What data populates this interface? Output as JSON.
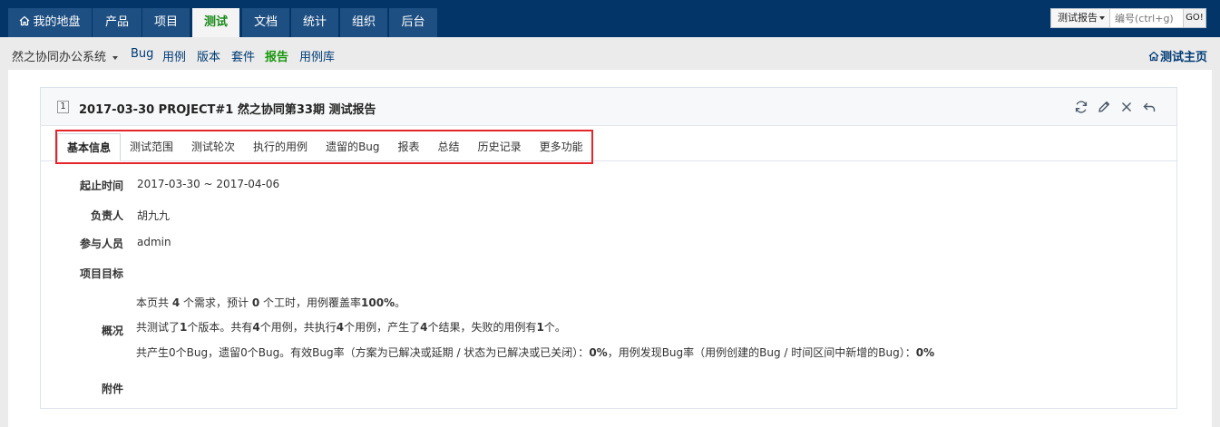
{
  "nav": {
    "tabs": [
      "我的地盘",
      "产品",
      "项目",
      "测试",
      "文档",
      "统计",
      "组织",
      "后台"
    ],
    "active_tab": "测试",
    "quick_search": {
      "type_label": "测试报告",
      "placeholder": "编号(ctrl+g)",
      "go_label": "GO!"
    }
  },
  "subnav": {
    "crumb": "然之协同办公系统",
    "items": [
      "Bug",
      "用例",
      "版本",
      "套件",
      "报告",
      "用例库"
    ],
    "active_item": "报告",
    "test_home": "测试主页"
  },
  "report": {
    "id": "1",
    "title": "2017-03-30 PROJECT#1 然之协同第33期 测试报告",
    "tabs": [
      "基本信息",
      "测试范围",
      "测试轮次",
      "执行的用例",
      "遗留的Bug",
      "报表",
      "总结",
      "历史记录",
      "更多功能"
    ],
    "active_tab": "基本信息",
    "fields": {
      "period_label": "起止时间",
      "period_value": "2017-03-30 ~ 2017-04-06",
      "owner_label": "负责人",
      "owner_value": "胡九九",
      "members_label": "参与人员",
      "members_value": "admin",
      "goal_label": "项目目标",
      "summary_label": "概况",
      "attach_label": "附件"
    },
    "summary": {
      "line1_a": "本页共 ",
      "line1_req": "4",
      "line1_b": " 个需求，预计 ",
      "line1_hours": "0",
      "line1_c": " 个工时，用例覆盖率",
      "line1_cov": "100%",
      "line1_d": "。",
      "line2_a": "共测试了",
      "line2_builds": "1",
      "line2_b": "个版本。共有",
      "line2_cases": "4",
      "line2_c": "个用例，共执行",
      "line2_runs": "4",
      "line2_d": "个用例，产生了",
      "line2_results": "4",
      "line2_e": "个结果，失败的用例有",
      "line2_fail": "1",
      "line2_f": "个。",
      "line3_a": "共产生0个Bug，遗留0个Bug。有效Bug率（方案为已解决或延期 / 状态为已解决或已关闭）：",
      "line3_rate1": "0%",
      "line3_b": "，用例发现Bug率（用例创建的Bug / 时间区间中新增的Bug）：",
      "line3_rate2": "0%"
    }
  },
  "colors": {
    "topbar": "#033568",
    "active_green": "#17970c",
    "highlight_red": "#e4262b",
    "link": "#003b75"
  }
}
